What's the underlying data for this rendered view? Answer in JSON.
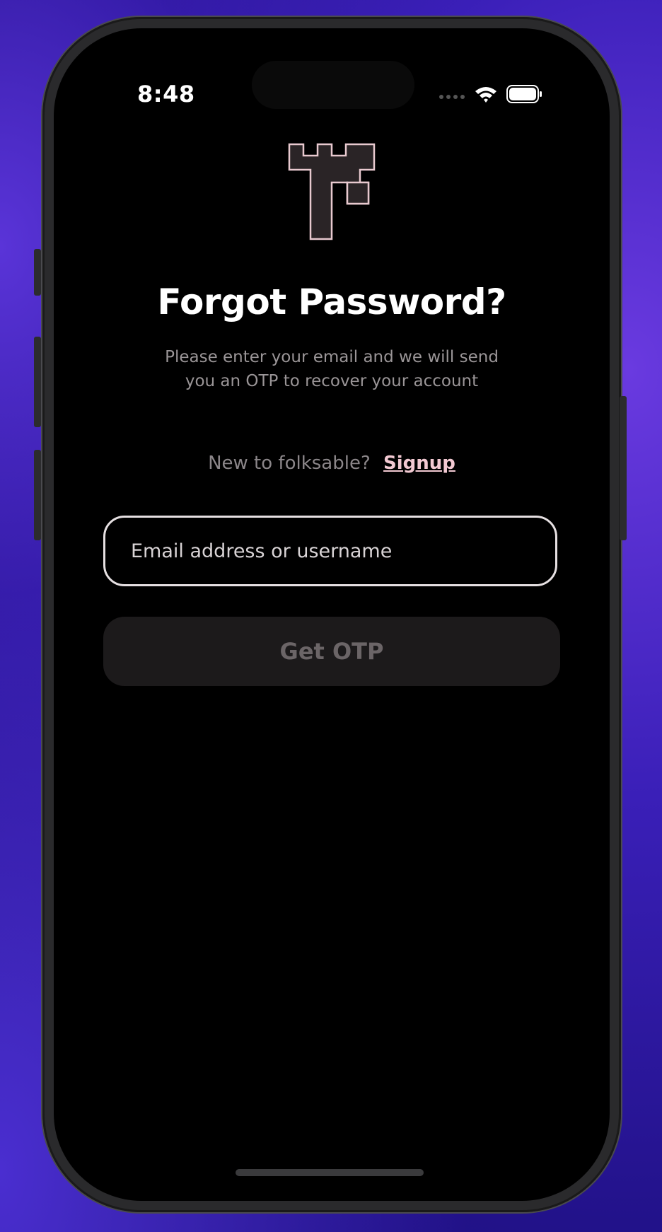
{
  "status_bar": {
    "time": "8:48",
    "icons": [
      "cellular-signal-icon",
      "wifi-icon",
      "battery-icon"
    ]
  },
  "logo": {
    "icon": "castle-tower-logo-icon",
    "fill": "#2a2426",
    "stroke": "#e8c9cf"
  },
  "title": "Forgot Password?",
  "subtitle_line1": "Please enter your email and we will send",
  "subtitle_line2": "you an OTP to recover your account",
  "signup": {
    "prompt": "New to folksable?",
    "link": "Signup"
  },
  "email_field": {
    "value": "",
    "placeholder": "Email address or username"
  },
  "otp_button": {
    "label": "Get OTP",
    "disabled": true
  },
  "colors": {
    "background": "#000000",
    "accent_link": "#f2c9d2",
    "button_disabled_bg": "#1c1a1b",
    "button_disabled_text": "#6b6567"
  }
}
